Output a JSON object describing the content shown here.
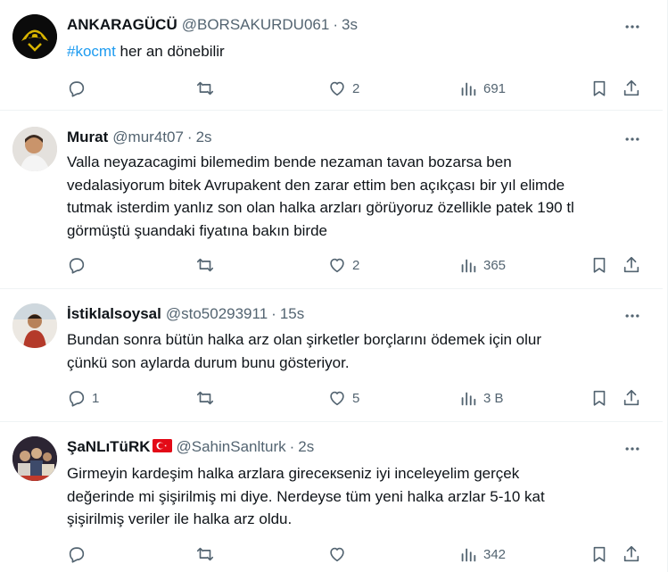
{
  "tweets": [
    {
      "name": "ANKARAGÜCÜ",
      "handle": "@BORSAKURDU061",
      "time": "3s",
      "hashtag": "#kocmt",
      "text": " her an dönebilir",
      "replies": "",
      "retweets": "",
      "likes": "2",
      "views": "691",
      "avatar_icon": "snake-logo-avatar"
    },
    {
      "name": "Murat",
      "handle": "@mur4t07",
      "time": "2s",
      "text": "Valla neyazacagimi bilemedim bende nezaman tavan bozarsa ben\nvedalasiyorum bitek Avrupakent den zarar ettim ben açıkçası bir yıl elimde\ntutmak isterdim yanlız son olan halka arzları görüyoruz özellikle patek 190 tl\ngörmüştü şuandaki fiyatına bakın birde",
      "replies": "",
      "retweets": "",
      "likes": "2",
      "views": "365",
      "avatar_icon": "person-photo-avatar"
    },
    {
      "name": "İstiklalsoysal",
      "handle": "@sto50293911",
      "time": "15s",
      "text": "Bundan sonra bütün halka arz olan şirketler borçlarını ödemek için olur\nçünkü son aylarda durum bunu gösteriyor.",
      "replies": "1",
      "retweets": "",
      "likes": "5",
      "views": "3 B",
      "avatar_icon": "person-photo-avatar"
    },
    {
      "name": "ŞaNLıTüRK",
      "handle": "@SahinSanlturk",
      "time": "2s",
      "text": "Girmeyin kardeşim halka arzlara gireceкseniz iyi inceleyelim gerçek\ndeğerinde mi şişirilmiş mi diye. Nerdeyse tüm yeni halka arzlar 5-10 kat\nşişirilmiş veriler ile halka arz oldu.",
      "replies": "",
      "retweets": "",
      "likes": "",
      "views": "342",
      "avatar_icon": "group-photo-avatar"
    }
  ],
  "icons": {
    "more": "more-icon",
    "reply": "reply-icon",
    "retweet": "retweet-icon",
    "like": "like-icon",
    "views": "views-icon",
    "bookmark": "bookmark-icon",
    "share": "share-icon",
    "flag": "turkey-flag-icon"
  },
  "colors": {
    "link": "#1d9bf0",
    "secondary": "#536471",
    "text": "#0f1419",
    "divider": "#eff3f4"
  }
}
